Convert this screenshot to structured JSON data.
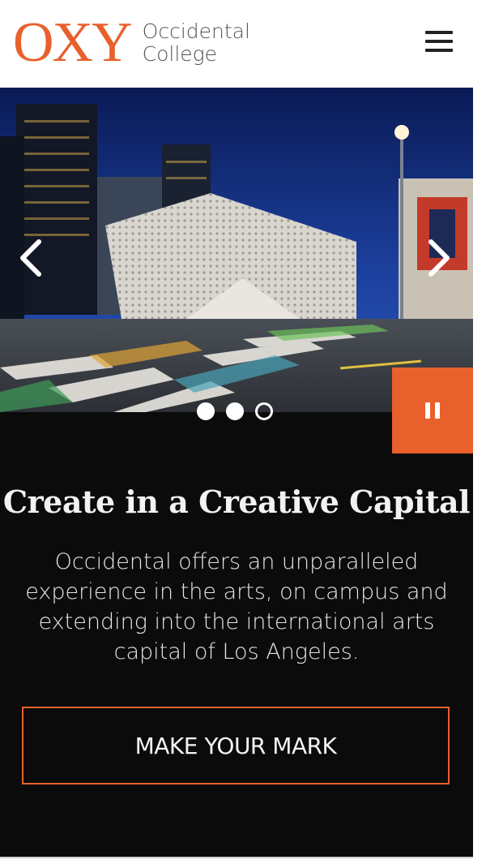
{
  "header": {
    "logo_mark": "OXY",
    "logo_line1": "Occidental",
    "logo_line2": "College",
    "menu_icon": "hamburger-menu-icon",
    "accent_color": "#e8602b"
  },
  "carousel": {
    "prev_icon": "chevron-left-icon",
    "next_icon": "chevron-right-icon",
    "slide_count": 3,
    "active_slide": 2,
    "pause_icon": "pause-icon",
    "image_alt": "Night view of a downtown Los Angeles street with a white perforated museum building and a painted crosswalk"
  },
  "hero": {
    "title": "Create in a Creative Capital",
    "text": "Occidental offers an unparalleled experience in the arts, on campus and extending into the international arts capital of Los Angeles.",
    "cta_label": "MAKE YOUR MARK"
  }
}
